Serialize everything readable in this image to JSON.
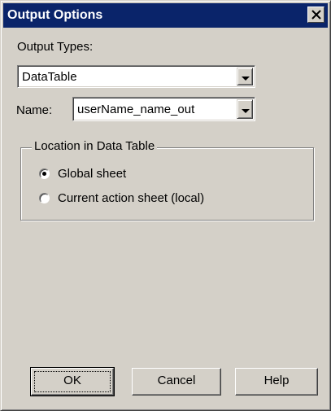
{
  "window": {
    "title": "Output Options",
    "close_icon": "close-icon"
  },
  "output_types": {
    "label": "Output Types:",
    "selected": "DataTable"
  },
  "name": {
    "label": "Name:",
    "selected": "userName_name_out"
  },
  "location": {
    "legend": "Location in Data Table",
    "options": [
      {
        "label": "Global sheet",
        "checked": true
      },
      {
        "label": "Current action sheet (local)",
        "checked": false
      }
    ]
  },
  "buttons": {
    "ok": "OK",
    "cancel": "Cancel",
    "help": "Help"
  },
  "colors": {
    "titlebar": "#0a246a",
    "face": "#d4d0c8"
  }
}
